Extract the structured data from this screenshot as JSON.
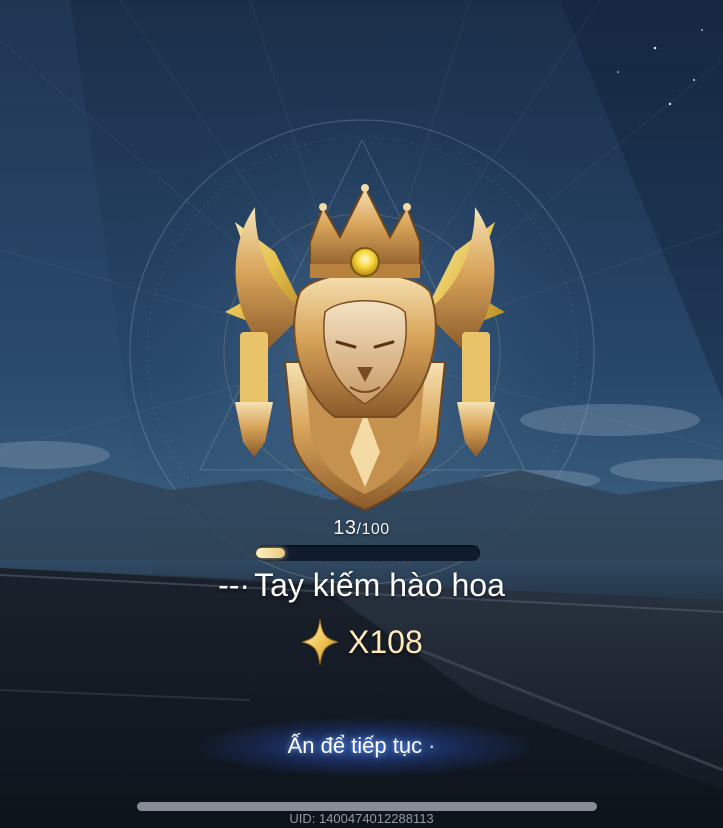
{
  "progress": {
    "current": "13",
    "separator": "/",
    "max": "100",
    "fraction": 0.13
  },
  "title": {
    "prefix": "--·",
    "text": "Tay kiếm hào hoa"
  },
  "reward": {
    "icon": "gold-star-icon",
    "count": "X108"
  },
  "continue": {
    "label": "Ấn để tiếp tục",
    "dot": "·"
  },
  "uid": "UID: 1400474012288113",
  "colors": {
    "sky_top": "#1e3350",
    "sky_bottom": "#2c5070",
    "ground": "#1c2433",
    "gold": "#d8a857",
    "accent_blue": "#3c78ff"
  },
  "emblem": {
    "icon": "lion-crown-shield-emblem"
  }
}
